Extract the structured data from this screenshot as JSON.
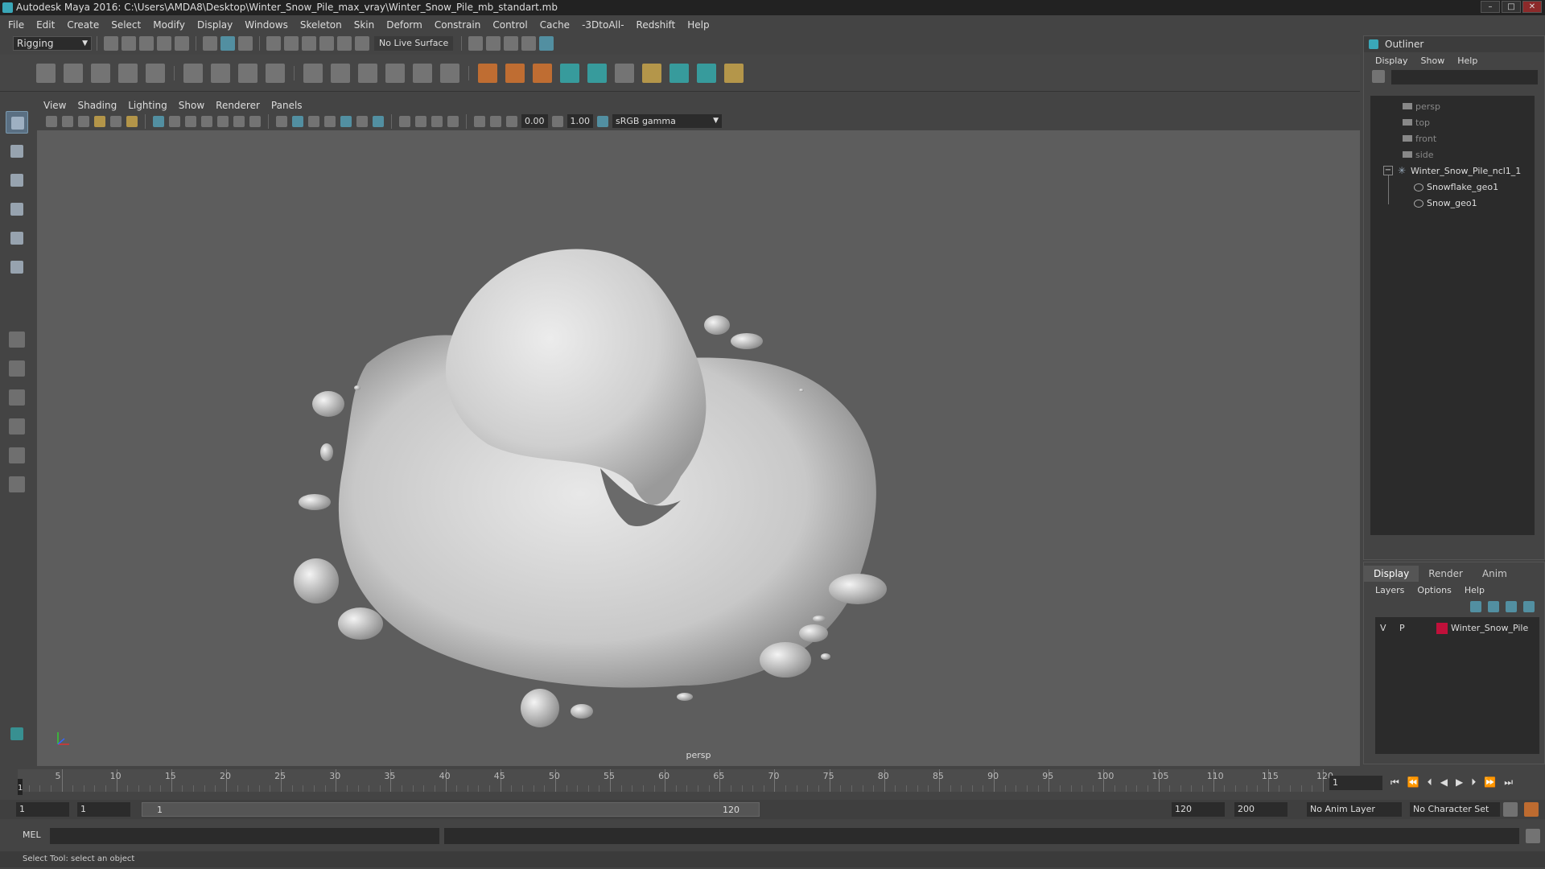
{
  "window": {
    "title": "Autodesk Maya 2016: C:\\Users\\AMDA8\\Desktop\\Winter_Snow_Pile_max_vray\\Winter_Snow_Pile_mb_standart.mb",
    "minimize": "–",
    "maximize": "□",
    "close": "✕"
  },
  "menubar": [
    "File",
    "Edit",
    "Create",
    "Select",
    "Modify",
    "Display",
    "Windows",
    "Skeleton",
    "Skin",
    "Deform",
    "Constrain",
    "Control",
    "Cache",
    "-3DtoAll-",
    "Redshift",
    "Help"
  ],
  "status": {
    "mode": "Rigging",
    "live_surface": "No Live Surface"
  },
  "viewport": {
    "menu": [
      "View",
      "Shading",
      "Lighting",
      "Show",
      "Renderer",
      "Panels"
    ],
    "field1": "0.00",
    "field2": "1.00",
    "color_space": "sRGB gamma",
    "camera_label": "persp"
  },
  "timeline": {
    "ticks": [
      "5",
      "10",
      "15",
      "20",
      "25",
      "30",
      "35",
      "40",
      "45",
      "50",
      "55",
      "60",
      "65",
      "70",
      "75",
      "80",
      "85",
      "90",
      "95",
      "100",
      "105",
      "110",
      "115",
      "120"
    ],
    "current_frame": "1",
    "frame_marker": "1"
  },
  "range": {
    "start": "1",
    "playback_start": "1",
    "slider_start": "1",
    "slider_end": "120",
    "playback_end": "120",
    "end": "200",
    "anim_layer": "No Anim Layer",
    "character_set": "No Character Set"
  },
  "command": {
    "label": "MEL"
  },
  "status_line": "Select Tool: select an object",
  "outliner": {
    "title": "Outliner",
    "menu": [
      "Display",
      "Show",
      "Help"
    ],
    "items": [
      {
        "label": "persp",
        "type": "camera"
      },
      {
        "label": "top",
        "type": "camera"
      },
      {
        "label": "front",
        "type": "camera"
      },
      {
        "label": "side",
        "type": "camera"
      },
      {
        "label": "Winter_Snow_Pile_ncl1_1",
        "type": "group"
      },
      {
        "label": "Snowflake_geo1",
        "type": "mesh"
      },
      {
        "label": "Snow_geo1",
        "type": "mesh"
      }
    ],
    "expand_toggle": "−"
  },
  "layers": {
    "tabs": [
      "Display",
      "Render",
      "Anim"
    ],
    "menu": [
      "Layers",
      "Options",
      "Help"
    ],
    "row": {
      "v": "V",
      "p": "P",
      "name": "Winter_Snow_Pile",
      "color": "#c0103a"
    }
  },
  "colors": {
    "accent": "#5bb9d4",
    "layer_color": "#c0103a"
  }
}
